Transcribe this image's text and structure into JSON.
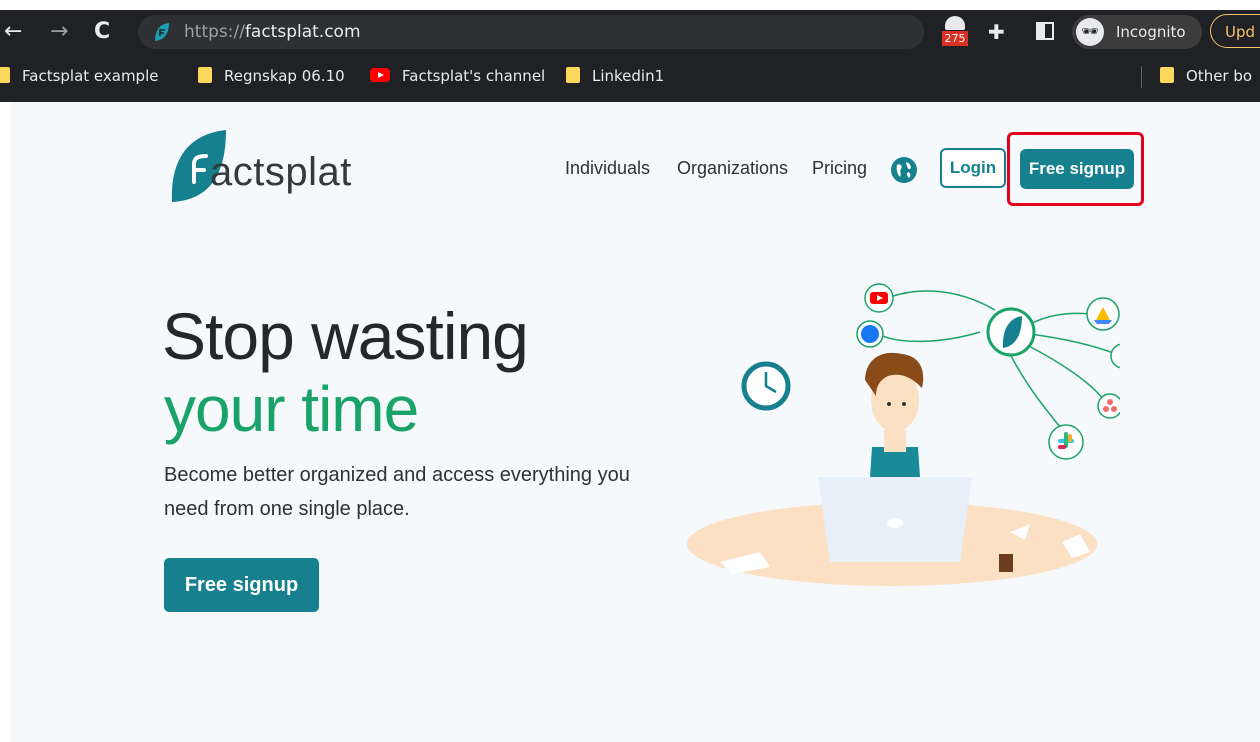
{
  "browser": {
    "url_scheme": "https://",
    "url_host": "factsplat.com",
    "extension_badge": "275",
    "incognito_label": "Incognito",
    "update_label": "Upd"
  },
  "bookmarks": [
    {
      "label": "Factsplat example",
      "icon": "folder-icon"
    },
    {
      "label": "Regnskap 06.10",
      "icon": "folder-icon"
    },
    {
      "label": "Factsplat's channel",
      "icon": "youtube-icon"
    },
    {
      "label": "Linkedin1",
      "icon": "folder-icon"
    }
  ],
  "other_bookmarks": "Other bo",
  "site": {
    "logo_text": "actsplat",
    "nav": {
      "individuals": "Individuals",
      "organizations": "Organizations",
      "pricing": "Pricing",
      "login": "Login",
      "signup": "Free signup"
    },
    "hero": {
      "line1": "Stop wasting",
      "line2": "your time",
      "subtitle": "Become better organized and access everything you need from one single place.",
      "cta": "Free signup"
    }
  },
  "colors": {
    "brand_teal": "#16808f",
    "hero_green": "#1aa368",
    "highlight_red": "#e4001a"
  }
}
